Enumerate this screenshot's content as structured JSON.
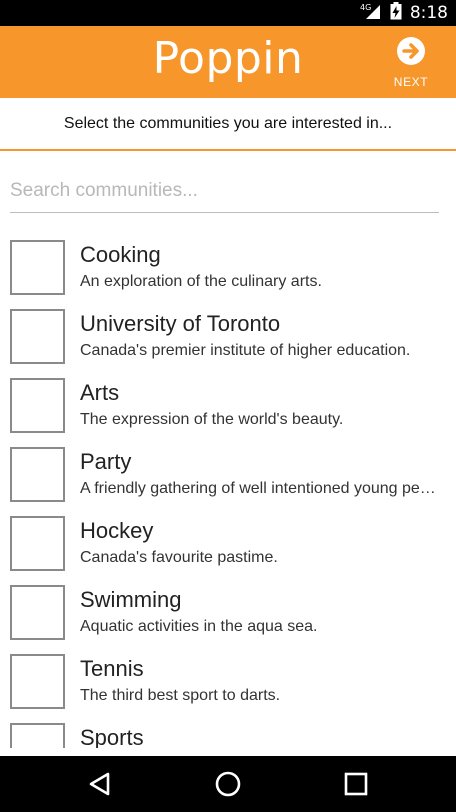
{
  "status_bar": {
    "network": "4G",
    "time": "8:18"
  },
  "app_bar": {
    "title": "Poppin",
    "next_label": "NEXT",
    "background_color": "#f7962a",
    "next_icon": "arrow-right-circle-icon"
  },
  "instruction": "Select the communities you are interested in...",
  "search": {
    "placeholder": "Search communities...",
    "value": ""
  },
  "communities": [
    {
      "title": "Cooking",
      "description": "An exploration of the culinary arts.",
      "checked": false
    },
    {
      "title": "University of Toronto",
      "description": "Canada's premier institute of higher education.",
      "checked": false
    },
    {
      "title": "Arts",
      "description": "The expression of the world's beauty.",
      "checked": false
    },
    {
      "title": "Party",
      "description": "A friendly gathering of well intentioned young people.",
      "checked": false
    },
    {
      "title": "Hockey",
      "description": "Canada's favourite pastime.",
      "checked": false
    },
    {
      "title": "Swimming",
      "description": "Aquatic activities in the aqua sea.",
      "checked": false
    },
    {
      "title": "Tennis",
      "description": "The third best sport to darts.",
      "checked": false
    },
    {
      "title": "Sports",
      "description": "",
      "checked": false
    }
  ],
  "nav_bar": {
    "back_icon": "back-triangle-icon",
    "home_icon": "home-circle-icon",
    "recents_icon": "recents-square-icon"
  }
}
